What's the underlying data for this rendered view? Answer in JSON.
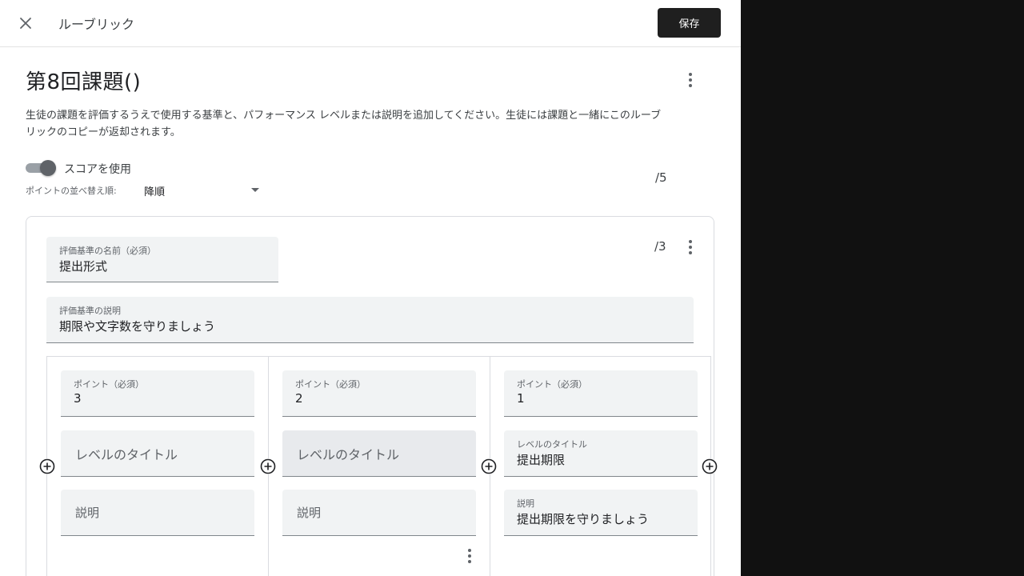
{
  "topbar": {
    "title": "ルーブリック",
    "save_label": "保存",
    "close_icon": "close-icon"
  },
  "rubric": {
    "title": "第8回課題()",
    "description": "生徒の課題を評価するうえで使用する基準と、パフォーマンス レベルまたは説明を追加してください。生徒には課題と一緒にこのルーブリックのコピーが返却されます。",
    "use_scores_label": "スコアを使用",
    "use_scores_on": true,
    "sort_label": "ポイントの並べ替え順:",
    "sort_value": "降順",
    "total_score": "/5"
  },
  "criterion": {
    "name_label": "評価基準の名前（必須）",
    "name_value": "提出形式",
    "desc_label": "評価基準の説明",
    "desc_value": "期限や文字数を守りましょう",
    "score": "/3",
    "levels": [
      {
        "points_label": "ポイント（必須）",
        "points_value": "3",
        "title_placeholder": "レベルのタイトル",
        "desc_placeholder": "説明"
      },
      {
        "points_label": "ポイント（必須）",
        "points_value": "2",
        "title_placeholder": "レベルのタイトル",
        "desc_placeholder": "説明"
      },
      {
        "points_label": "ポイント（必須）",
        "points_value": "1",
        "title_label": "レベルのタイトル",
        "title_value": "提出期限",
        "desc_label": "説明",
        "desc_value": "提出期限を守りましょう"
      }
    ]
  },
  "colors": {
    "save_bg": "#1f1f1f",
    "field_bg": "#f1f3f4",
    "toggle_thumb": "#5f6368",
    "backdrop": "#111111"
  }
}
